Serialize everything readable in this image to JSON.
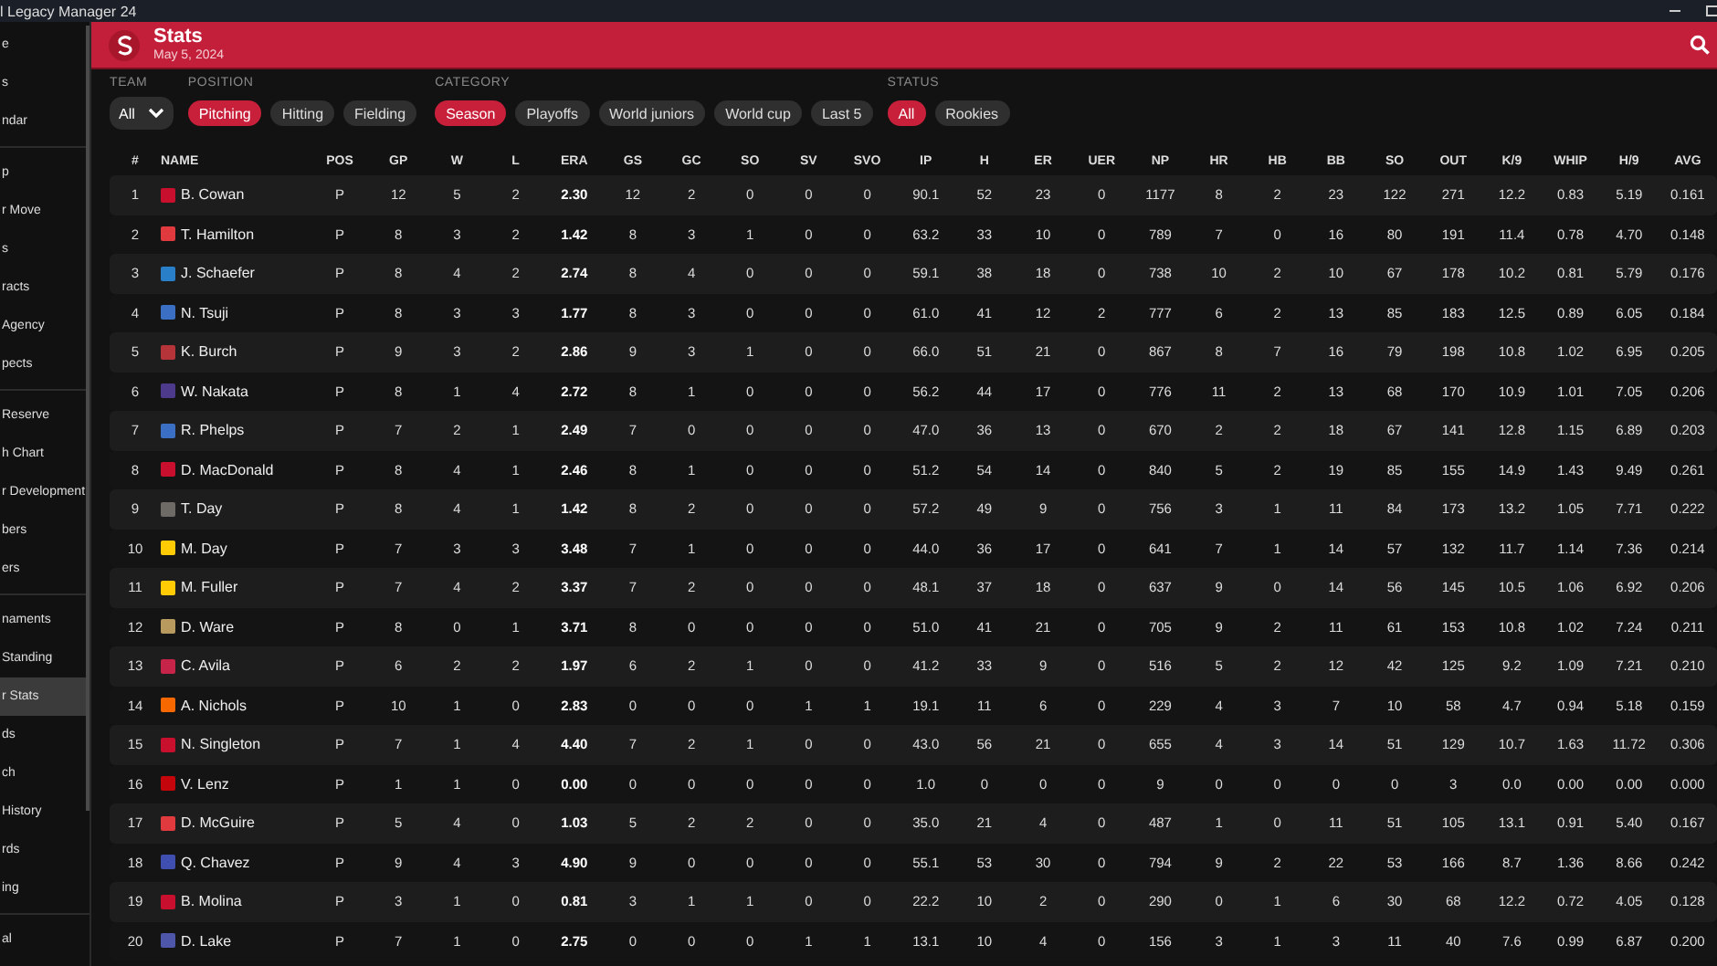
{
  "app_title": "l Legacy Manager 24",
  "sidebar": {
    "sections": [
      {
        "items": [
          {
            "label": "e",
            "selected": false
          },
          {
            "label": "s",
            "selected": false
          },
          {
            "label": "ndar",
            "selected": false
          }
        ]
      },
      {
        "items": [
          {
            "label": "p",
            "selected": false
          },
          {
            "label": "r Move",
            "selected": false
          },
          {
            "label": "s",
            "selected": false
          },
          {
            "label": "racts",
            "selected": false
          },
          {
            "label": "Agency",
            "selected": false
          },
          {
            "label": "pects",
            "selected": false
          }
        ]
      },
      {
        "items": [
          {
            "label": "Reserve",
            "selected": false
          },
          {
            "label": "h Chart",
            "selected": false
          },
          {
            "label": "r Development",
            "selected": false
          },
          {
            "label": "bers",
            "selected": false
          },
          {
            "label": "ers",
            "selected": false
          }
        ]
      },
      {
        "items": [
          {
            "label": "naments",
            "selected": false
          },
          {
            "label": "Standing",
            "selected": false
          },
          {
            "label": "r Stats",
            "selected": true
          },
          {
            "label": "ds",
            "selected": false
          },
          {
            "label": "ch",
            "selected": false
          },
          {
            "label": "History",
            "selected": false
          },
          {
            "label": "rds",
            "selected": false
          },
          {
            "label": "ing",
            "selected": false
          }
        ]
      },
      {
        "items": [
          {
            "label": "al",
            "selected": false
          }
        ]
      }
    ]
  },
  "header": {
    "title": "Stats",
    "date": "May 5, 2024"
  },
  "filters": [
    {
      "label": "TEAM",
      "kind": "select",
      "value": "All"
    },
    {
      "label": "POSITION",
      "kind": "pills",
      "options": [
        {
          "label": "Pitching",
          "selected": true
        },
        {
          "label": "Hitting",
          "selected": false
        },
        {
          "label": "Fielding",
          "selected": false
        }
      ]
    },
    {
      "label": "CATEGORY",
      "kind": "pills",
      "options": [
        {
          "label": "Season",
          "selected": true
        },
        {
          "label": "Playoffs",
          "selected": false
        },
        {
          "label": "World juniors",
          "selected": false
        },
        {
          "label": "World cup",
          "selected": false
        },
        {
          "label": "Last 5",
          "selected": false
        }
      ]
    },
    {
      "label": "STATUS",
      "kind": "pills",
      "options": [
        {
          "label": "All",
          "selected": true
        },
        {
          "label": "Rookies",
          "selected": false
        }
      ]
    }
  ],
  "table": {
    "columns": [
      "#",
      "NAME",
      "POS",
      "GP",
      "W",
      "L",
      "ERA",
      "GS",
      "GC",
      "SO",
      "SV",
      "SVO",
      "IP",
      "H",
      "ER",
      "UER",
      "NP",
      "HR",
      "HB",
      "BB",
      "SO",
      "OUT",
      "K/9",
      "WHIP",
      "H/9",
      "AVG"
    ],
    "rows": [
      {
        "color": "#c8102e",
        "cells": [
          "1",
          "B. Cowan",
          "P",
          "12",
          "5",
          "2",
          "2.30",
          "12",
          "2",
          "0",
          "0",
          "0",
          "90.1",
          "52",
          "23",
          "0",
          "1177",
          "8",
          "2",
          "23",
          "122",
          "271",
          "12.2",
          "0.83",
          "5.19",
          "0.161"
        ]
      },
      {
        "color": "#e03a3e",
        "cells": [
          "2",
          "T. Hamilton",
          "P",
          "8",
          "3",
          "2",
          "1.42",
          "8",
          "3",
          "1",
          "0",
          "0",
          "63.2",
          "33",
          "10",
          "0",
          "789",
          "7",
          "0",
          "16",
          "80",
          "191",
          "11.4",
          "0.78",
          "4.70",
          "0.148"
        ]
      },
      {
        "color": "#2a7fc9",
        "cells": [
          "3",
          "J. Schaefer",
          "P",
          "8",
          "4",
          "2",
          "2.74",
          "8",
          "4",
          "0",
          "0",
          "0",
          "59.1",
          "38",
          "18",
          "0",
          "738",
          "10",
          "2",
          "10",
          "67",
          "178",
          "10.2",
          "0.81",
          "5.79",
          "0.176"
        ]
      },
      {
        "color": "#3a6fc4",
        "cells": [
          "4",
          "N. Tsuji",
          "P",
          "8",
          "3",
          "3",
          "1.77",
          "8",
          "3",
          "0",
          "0",
          "0",
          "61.0",
          "41",
          "12",
          "2",
          "777",
          "6",
          "2",
          "13",
          "85",
          "183",
          "12.5",
          "0.89",
          "6.05",
          "0.184"
        ]
      },
      {
        "color": "#b5343a",
        "cells": [
          "5",
          "K. Burch",
          "P",
          "9",
          "3",
          "2",
          "2.86",
          "9",
          "3",
          "1",
          "0",
          "0",
          "66.0",
          "51",
          "21",
          "0",
          "867",
          "8",
          "7",
          "16",
          "79",
          "198",
          "10.8",
          "1.02",
          "6.95",
          "0.205"
        ]
      },
      {
        "color": "#4e3a8a",
        "cells": [
          "6",
          "W. Nakata",
          "P",
          "8",
          "1",
          "4",
          "2.72",
          "8",
          "1",
          "0",
          "0",
          "0",
          "56.2",
          "44",
          "17",
          "0",
          "776",
          "11",
          "2",
          "13",
          "68",
          "170",
          "10.9",
          "1.01",
          "7.05",
          "0.206"
        ]
      },
      {
        "color": "#3a6fc4",
        "cells": [
          "7",
          "R. Phelps",
          "P",
          "7",
          "2",
          "1",
          "2.49",
          "7",
          "0",
          "0",
          "0",
          "0",
          "47.0",
          "36",
          "13",
          "0",
          "670",
          "2",
          "2",
          "18",
          "67",
          "141",
          "12.8",
          "1.15",
          "6.89",
          "0.203"
        ]
      },
      {
        "color": "#c8102e",
        "cells": [
          "8",
          "D. MacDonald",
          "P",
          "8",
          "4",
          "1",
          "2.46",
          "8",
          "1",
          "0",
          "0",
          "0",
          "51.2",
          "54",
          "14",
          "0",
          "840",
          "5",
          "2",
          "19",
          "85",
          "155",
          "14.9",
          "1.43",
          "9.49",
          "0.261"
        ]
      },
      {
        "color": "#6e6a66",
        "cells": [
          "9",
          "T. Day",
          "P",
          "8",
          "4",
          "1",
          "1.42",
          "8",
          "2",
          "0",
          "0",
          "0",
          "57.2",
          "49",
          "9",
          "0",
          "756",
          "3",
          "1",
          "11",
          "84",
          "173",
          "13.2",
          "1.05",
          "7.71",
          "0.222"
        ]
      },
      {
        "color": "#ffcb05",
        "cells": [
          "10",
          "M. Day",
          "P",
          "7",
          "3",
          "3",
          "3.48",
          "7",
          "1",
          "0",
          "0",
          "0",
          "44.0",
          "36",
          "17",
          "0",
          "641",
          "7",
          "1",
          "14",
          "57",
          "132",
          "11.7",
          "1.14",
          "7.36",
          "0.214"
        ]
      },
      {
        "color": "#ffcb05",
        "cells": [
          "11",
          "M. Fuller",
          "P",
          "7",
          "4",
          "2",
          "3.37",
          "7",
          "2",
          "0",
          "0",
          "0",
          "48.1",
          "37",
          "18",
          "0",
          "637",
          "9",
          "0",
          "14",
          "56",
          "145",
          "10.5",
          "1.06",
          "6.92",
          "0.206"
        ]
      },
      {
        "color": "#b89a5e",
        "cells": [
          "12",
          "D. Ware",
          "P",
          "8",
          "0",
          "1",
          "3.71",
          "8",
          "0",
          "0",
          "0",
          "0",
          "51.0",
          "41",
          "21",
          "0",
          "705",
          "9",
          "2",
          "11",
          "61",
          "153",
          "10.8",
          "1.02",
          "7.24",
          "0.211"
        ]
      },
      {
        "color": "#c7244a",
        "cells": [
          "13",
          "C. Avila",
          "P",
          "6",
          "2",
          "2",
          "1.97",
          "6",
          "2",
          "1",
          "0",
          "0",
          "41.2",
          "33",
          "9",
          "0",
          "516",
          "5",
          "2",
          "12",
          "42",
          "125",
          "9.2",
          "1.09",
          "7.21",
          "0.210"
        ]
      },
      {
        "color": "#f76900",
        "cells": [
          "14",
          "A. Nichols",
          "P",
          "10",
          "1",
          "0",
          "2.83",
          "0",
          "0",
          "0",
          "1",
          "1",
          "19.1",
          "11",
          "6",
          "0",
          "229",
          "4",
          "3",
          "7",
          "10",
          "58",
          "4.7",
          "0.94",
          "5.18",
          "0.159"
        ]
      },
      {
        "color": "#c8102e",
        "cells": [
          "15",
          "N. Singleton",
          "P",
          "7",
          "1",
          "4",
          "4.40",
          "7",
          "2",
          "1",
          "0",
          "0",
          "43.0",
          "56",
          "21",
          "0",
          "655",
          "4",
          "3",
          "14",
          "51",
          "129",
          "10.7",
          "1.63",
          "11.72",
          "0.306"
        ]
      },
      {
        "color": "#c5050c",
        "cells": [
          "16",
          "V. Lenz",
          "P",
          "1",
          "1",
          "0",
          "0.00",
          "0",
          "0",
          "0",
          "0",
          "0",
          "1.0",
          "0",
          "0",
          "0",
          "9",
          "0",
          "0",
          "0",
          "0",
          "3",
          "0.0",
          "0.00",
          "0.00",
          "0.000"
        ]
      },
      {
        "color": "#e03a3e",
        "cells": [
          "17",
          "D. McGuire",
          "P",
          "5",
          "4",
          "0",
          "1.03",
          "5",
          "2",
          "2",
          "0",
          "0",
          "35.0",
          "21",
          "4",
          "0",
          "487",
          "1",
          "0",
          "11",
          "51",
          "105",
          "13.1",
          "0.91",
          "5.40",
          "0.167"
        ]
      },
      {
        "color": "#3f4fb0",
        "cells": [
          "18",
          "Q. Chavez",
          "P",
          "9",
          "4",
          "3",
          "4.90",
          "9",
          "0",
          "0",
          "0",
          "0",
          "55.1",
          "53",
          "30",
          "0",
          "794",
          "9",
          "2",
          "22",
          "53",
          "166",
          "8.7",
          "1.36",
          "8.66",
          "0.242"
        ]
      },
      {
        "color": "#c8102e",
        "cells": [
          "19",
          "B. Molina",
          "P",
          "3",
          "1",
          "0",
          "0.81",
          "3",
          "1",
          "1",
          "0",
          "0",
          "22.2",
          "10",
          "2",
          "0",
          "290",
          "0",
          "1",
          "6",
          "30",
          "68",
          "12.2",
          "0.72",
          "4.05",
          "0.128"
        ]
      },
      {
        "color": "#4d56a8",
        "cells": [
          "20",
          "D. Lake",
          "P",
          "7",
          "1",
          "0",
          "2.75",
          "0",
          "0",
          "0",
          "1",
          "1",
          "13.1",
          "10",
          "4",
          "0",
          "156",
          "3",
          "1",
          "3",
          "11",
          "40",
          "7.6",
          "0.99",
          "6.87",
          "0.200"
        ]
      }
    ]
  }
}
